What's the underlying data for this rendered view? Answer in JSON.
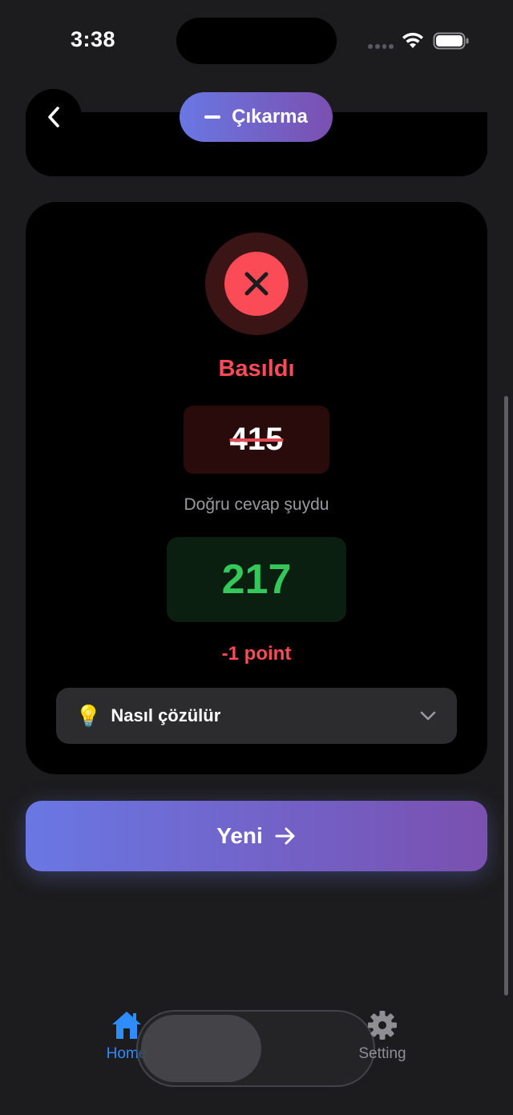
{
  "status_bar": {
    "time": "3:38"
  },
  "header": {
    "mode_label": "Çıkarma"
  },
  "result": {
    "status": "Basıldı",
    "given_answer": "415",
    "hint": "Doğru cevap şuydu",
    "correct_answer": "217",
    "points": "-1 point",
    "solve_label": "Nasıl çözülür",
    "bulb": "💡"
  },
  "actions": {
    "new_label": "Yeni"
  },
  "tabs": [
    {
      "label": "Home",
      "icon": "house-icon",
      "active": true
    },
    {
      "label": "Setting",
      "icon": "gear-icon",
      "active": false
    }
  ],
  "colors": {
    "accent_start": "#6a77e3",
    "accent_end": "#7a50b0",
    "error": "#fa4b57",
    "success": "#34c759",
    "tab_active": "#2f8cff"
  }
}
